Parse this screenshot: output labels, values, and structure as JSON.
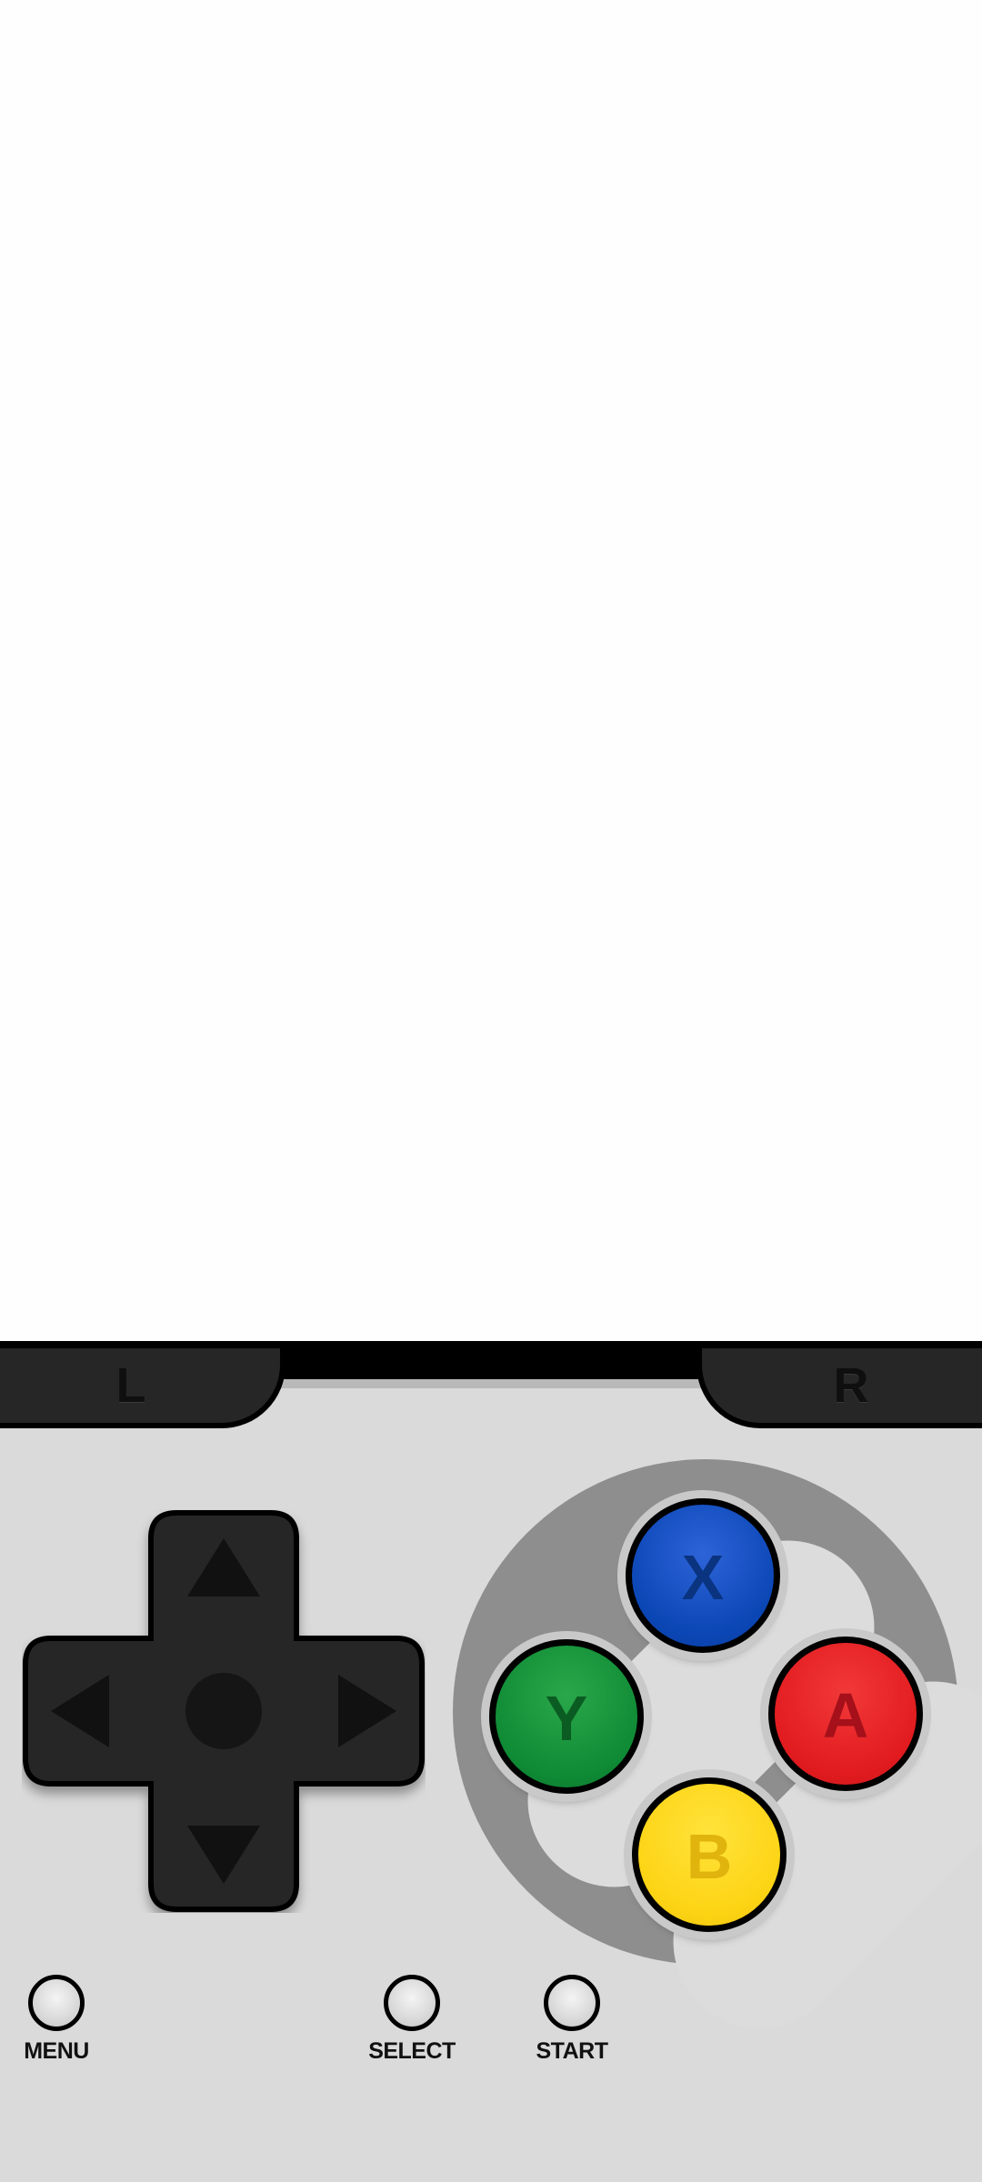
{
  "shoulders": {
    "left_label": "L",
    "right_label": "R"
  },
  "face_buttons": {
    "x": "X",
    "y": "Y",
    "a": "A",
    "b": "B"
  },
  "system_buttons": {
    "menu": "MENU",
    "select": "SELECT",
    "start": "START"
  },
  "colors": {
    "x": "#0b46b5",
    "y": "#0f8a35",
    "a": "#e11b1f",
    "b": "#fdd414",
    "body": "#dadada",
    "dpad": "#262626"
  }
}
